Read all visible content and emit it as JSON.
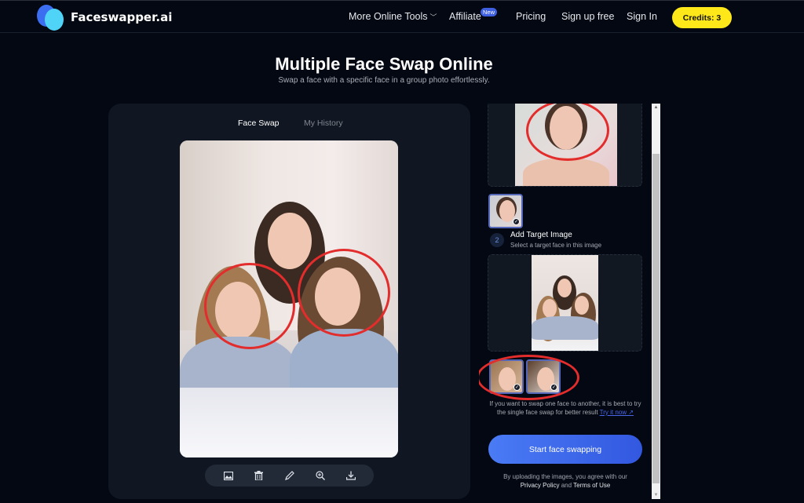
{
  "header": {
    "brand": "Faceswapper.ai",
    "nav": [
      {
        "label": "More Online Tools",
        "has_dropdown": true
      },
      {
        "label": "Affiliate",
        "badge": "New"
      },
      {
        "label": "Pricing"
      },
      {
        "label": "Sign up free"
      },
      {
        "label": "Sign In"
      }
    ],
    "credits_label": "Credits: 3",
    "credits_color": "#ffe81a"
  },
  "page": {
    "title": "Multiple Face Swap Online",
    "subtitle": "Swap a face with a specific face in a group photo effortlessly."
  },
  "left_panel": {
    "tabs": [
      {
        "label": "Face Swap",
        "active": true
      },
      {
        "label": "My History",
        "active": false
      }
    ],
    "toolbar": [
      {
        "icon": "image-icon",
        "label": "Replace image"
      },
      {
        "icon": "trash-icon",
        "label": "Delete"
      },
      {
        "icon": "pencil-icon",
        "label": "Edit"
      },
      {
        "icon": "zoom-in-icon",
        "label": "Zoom"
      },
      {
        "icon": "download-icon",
        "label": "Download"
      }
    ]
  },
  "right_panel": {
    "step2": {
      "number": "2",
      "title": "Add Target Image",
      "description": "Select a target face in this image"
    },
    "hint_text": "If you want to swap one face to another, it is best to try the single face swap for better result",
    "hint_link": "Try it now ↗",
    "start_button": "Start face swapping",
    "terms_prefix": "By uploading the images, you agree with our",
    "privacy_link": "Privacy Policy",
    "terms_and": "and",
    "terms_link": "Terms of Use",
    "accent_color": "#4a7bf5"
  }
}
